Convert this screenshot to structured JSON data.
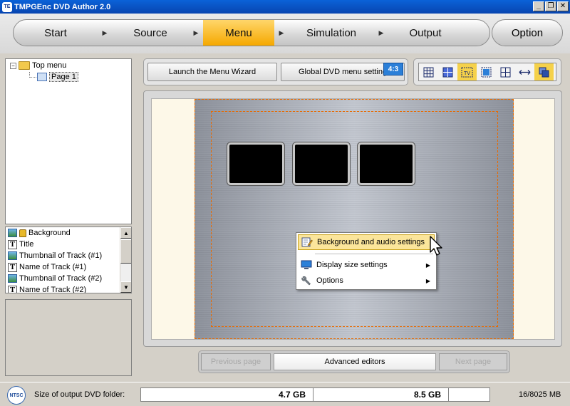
{
  "window": {
    "title": "TMPGEnc DVD Author 2.0",
    "icon_text": "TE",
    "controls": [
      "_",
      "❐",
      "✕"
    ]
  },
  "nav": {
    "tabs": [
      {
        "label": "Start",
        "active": false
      },
      {
        "label": "Source",
        "active": false
      },
      {
        "label": "Menu",
        "active": true
      },
      {
        "label": "Simulation",
        "active": false
      },
      {
        "label": "Output",
        "active": false
      }
    ],
    "option_label": "Option"
  },
  "tree": {
    "root": "Top menu",
    "child": "Page 1"
  },
  "elements_list": [
    {
      "label": "Background",
      "icon": "image-icon",
      "locked": true
    },
    {
      "label": "Title",
      "icon": "text-icon"
    },
    {
      "label": "Thumbnail of Track (#1)",
      "icon": "image-icon"
    },
    {
      "label": "Name of Track (#1)",
      "icon": "text-icon"
    },
    {
      "label": "Thumbnail of Track (#2)",
      "icon": "image-icon"
    },
    {
      "label": "Name of Track (#2)",
      "icon": "text-icon"
    }
  ],
  "toolbar": {
    "wizard_label": "Launch the Menu Wizard",
    "global_label": "Global DVD menu settings",
    "aspect": "4:3",
    "view_tools": [
      "grid-icon",
      "grid-fill-icon",
      "tv-safe-icon",
      "select-frame-icon",
      "center-guide-icon",
      "width-arrow-icon",
      "layers-icon"
    ]
  },
  "context_menu": {
    "items": [
      {
        "label": "Background and audio settings",
        "highlighted": true,
        "submenu": false
      },
      {
        "label": "Display size settings",
        "highlighted": false,
        "submenu": true
      },
      {
        "label": "Options",
        "highlighted": false,
        "submenu": true
      }
    ]
  },
  "page_nav": {
    "previous": "Previous page",
    "advanced": "Advanced editors",
    "next": "Next page"
  },
  "status": {
    "format": "NTSC",
    "label": "Size of output DVD folder:",
    "size_1": "4.7 GB",
    "size_2": "8.5 GB",
    "usage": "16/8025 MB"
  },
  "colors": {
    "active_tab": "#f5a800",
    "titlebar": "#0a62d8",
    "guide_line": "#e86a00",
    "highlight": "#fbe59a"
  }
}
